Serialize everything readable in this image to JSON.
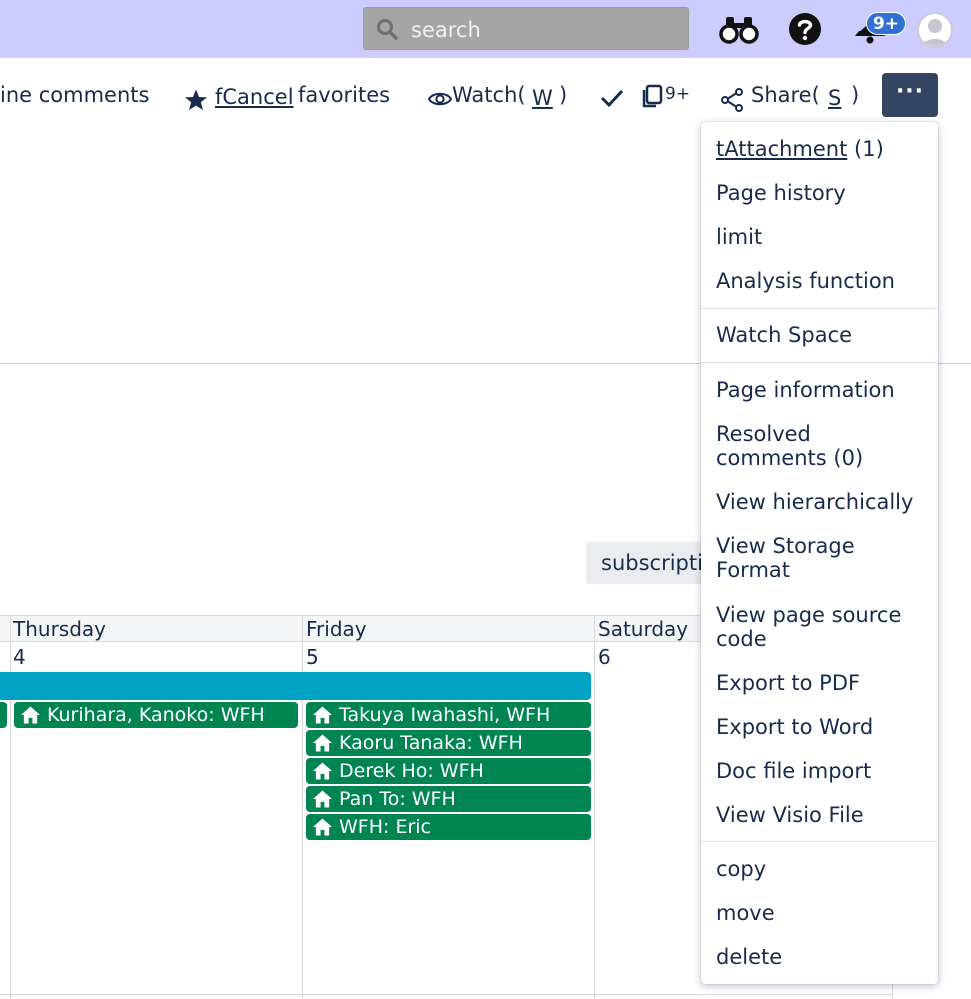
{
  "topbar": {
    "search_placeholder": "search",
    "notification_count": "9+",
    "icons": [
      "search-icon",
      "binoculars-icon",
      "help-icon",
      "notification-icon",
      "avatar-icon"
    ]
  },
  "toolbar": {
    "inline_comments": "ine comments",
    "favorites_shortcut": "fCancel",
    "favorites_label": "favorites",
    "watch_label": "Watch(",
    "watch_key": "W",
    "watch_close": ")",
    "copies_count": "9+",
    "share_label": "Share(",
    "share_key": "S",
    "share_close": ")",
    "more_label": "···"
  },
  "subscribe_label": "subscripti",
  "calendar": {
    "days": [
      {
        "name": "Thursday",
        "date": "4"
      },
      {
        "name": "Friday",
        "date": "5"
      },
      {
        "name": "Saturday",
        "date": "6"
      }
    ],
    "events": [
      {
        "day": "Thursday",
        "text": "Kurihara, Kanoko: WFH"
      },
      {
        "day": "Friday",
        "text": "Takuya Iwahashi, WFH"
      },
      {
        "day": "Friday",
        "text": "Kaoru Tanaka: WFH"
      },
      {
        "day": "Friday",
        "text": "Derek Ho: WFH"
      },
      {
        "day": "Friday",
        "text": "Pan To: WFH"
      },
      {
        "day": "Friday",
        "text": "WFH: Eric"
      }
    ]
  },
  "menu": {
    "attachment_key": "t",
    "attachment_label": "Attachment",
    "attachment_count": "(1)",
    "page_history": "Page history",
    "limit": "limit",
    "analysis": "Analysis function",
    "watch_space": "Watch Space",
    "page_information": "Page information",
    "resolved_comments_1": "Resolved",
    "resolved_comments_2": "comments (0)",
    "view_hierarchically": "View hierarchically",
    "view_storage_1": "View Storage",
    "view_storage_2": "Format",
    "view_source_1": "View page source",
    "view_source_2": "code",
    "export_pdf": "Export to PDF",
    "export_word": "Export to Word",
    "doc_import": "Doc file import",
    "view_visio": "View Visio File",
    "copy": "copy",
    "move": "move",
    "delete": "delete"
  },
  "colors": {
    "topbar": "#ccccff",
    "event_green": "#008452",
    "cyan_bar": "#00a3c4",
    "more_button": "#344563",
    "badge": "#2f6fd6"
  }
}
